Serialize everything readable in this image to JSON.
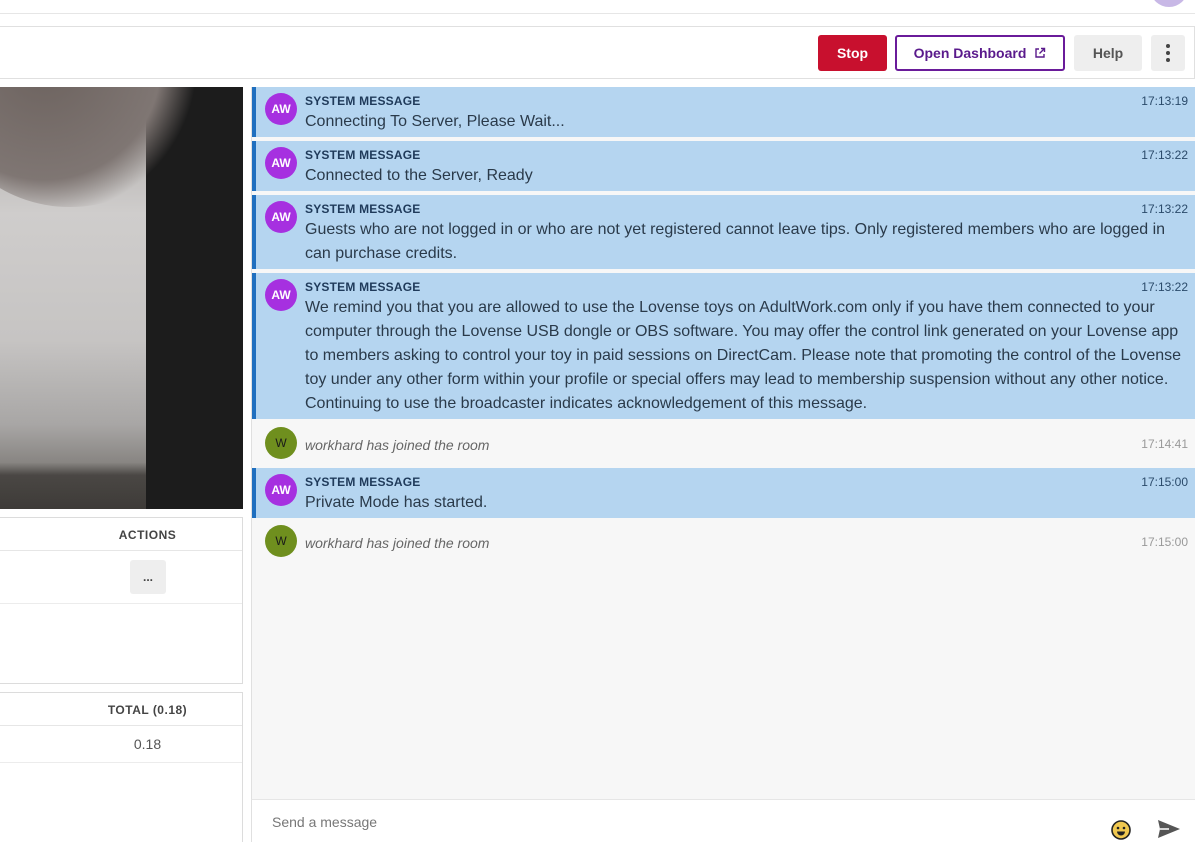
{
  "toolbar": {
    "stop_label": "Stop",
    "dashboard_label": "Open Dashboard",
    "help_label": "Help"
  },
  "colors": {
    "stop": "#c8102e",
    "dashboard_border": "#6a1b9a",
    "system_message_bg": "#b5d5f0",
    "system_message_accent": "#1f6fbf",
    "aw_avatar": "#a630e0",
    "user_avatar": "#6f8f1e"
  },
  "actions_panel": {
    "header": "ACTIONS",
    "more_button": "..."
  },
  "totals_panel": {
    "header": "TOTAL (0.18)",
    "value": "0.18"
  },
  "chat": {
    "messages": [
      {
        "type": "system",
        "avatar": "AW",
        "sender": "SYSTEM MESSAGE",
        "time": "17:13:19",
        "text": "Connecting To Server, Please Wait..."
      },
      {
        "type": "system",
        "avatar": "AW",
        "sender": "SYSTEM MESSAGE",
        "time": "17:13:22",
        "text": "Connected to the Server, Ready"
      },
      {
        "type": "system",
        "avatar": "AW",
        "sender": "SYSTEM MESSAGE",
        "time": "17:13:22",
        "text": "Guests who are not logged in or who are not yet registered cannot leave tips. Only registered members who are logged in can purchase credits."
      },
      {
        "type": "system",
        "avatar": "AW",
        "sender": "SYSTEM MESSAGE",
        "time": "17:13:22",
        "text": "We remind you that you are allowed to use the Lovense toys on AdultWork.com only if you have them connected to your computer through the Lovense USB dongle or OBS software. You may offer the control link generated on your Lovense app to members asking to control your toy in paid sessions on DirectCam. Please note that promoting the control of the Lovense toy under any other form within your profile or special offers may lead to membership suspension without any other notice. Continuing to use the broadcaster indicates acknowledgement of this message."
      },
      {
        "type": "join",
        "avatar": "W",
        "time": "17:14:41",
        "text": "workhard has joined the room"
      },
      {
        "type": "system",
        "avatar": "AW",
        "sender": "SYSTEM MESSAGE",
        "time": "17:15:00",
        "text": "Private Mode has started."
      },
      {
        "type": "join",
        "avatar": "W",
        "time": "17:15:00",
        "text": "workhard has joined the room"
      }
    ],
    "composer_placeholder": "Send a message",
    "emoji_icon": "smiley-face-icon",
    "send_icon": "send-arrow-icon"
  }
}
